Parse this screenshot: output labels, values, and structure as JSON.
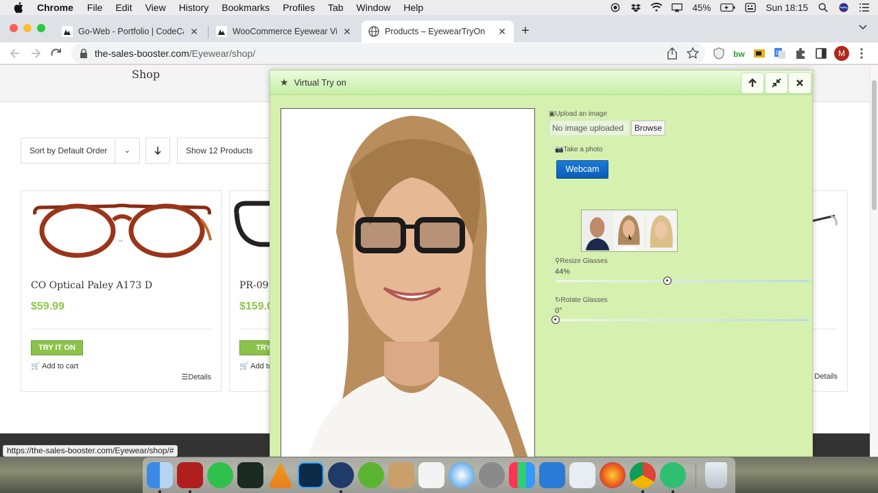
{
  "menubar": {
    "app": "Chrome",
    "items": [
      "File",
      "Edit",
      "View",
      "History",
      "Bookmarks",
      "Profiles",
      "Tab",
      "Window",
      "Help"
    ],
    "battery": "45%",
    "clock": "Sun 18:15"
  },
  "tabs": [
    {
      "title": "Go-Web - Portfolio | CodeCany",
      "active": false
    },
    {
      "title": "WooCommerce Eyewear Virtua",
      "active": false
    },
    {
      "title": "Products – EyewearTryOn",
      "active": true
    }
  ],
  "address": {
    "host": "the-sales-booster.com",
    "path": "/Eyewear/shop/"
  },
  "page": {
    "title": "Shop",
    "sort_label": "Sort by Default Order",
    "show_label": "Show 12 Products",
    "products": [
      {
        "name": "CO Optical Paley A173 D",
        "price": "$59.99",
        "try_label": "TRY IT ON",
        "cart_label": "Add to cart",
        "details_label": "Details"
      },
      {
        "name": "PR-09",
        "price": "$159.0",
        "try_label": "TRY I",
        "cart_label": "Add to",
        "details_label": ""
      },
      {
        "name": "",
        "price": "",
        "try_label": "",
        "cart_label": "",
        "details_label": "Details"
      }
    ]
  },
  "modal": {
    "title": "Virtual Try on",
    "upload_label": "Upload an image",
    "upload_value": "No image uploaded",
    "browse_label": "Browse",
    "photo_label": "Take a photo",
    "webcam_label": "Webcam",
    "resize_label": "Resize Glasses",
    "resize_value": "44%",
    "resize_fraction": 0.44,
    "rotate_label": "Rotate Glasses",
    "rotate_value": "0°",
    "rotate_fraction": 0.0
  },
  "status_url": "https://the-sales-booster.com/Eyewear/shop/#",
  "colors": {
    "price_green": "#8fc64a",
    "modal_bg": "#d6f0b0",
    "webcam_blue": "#0a5cb6"
  }
}
